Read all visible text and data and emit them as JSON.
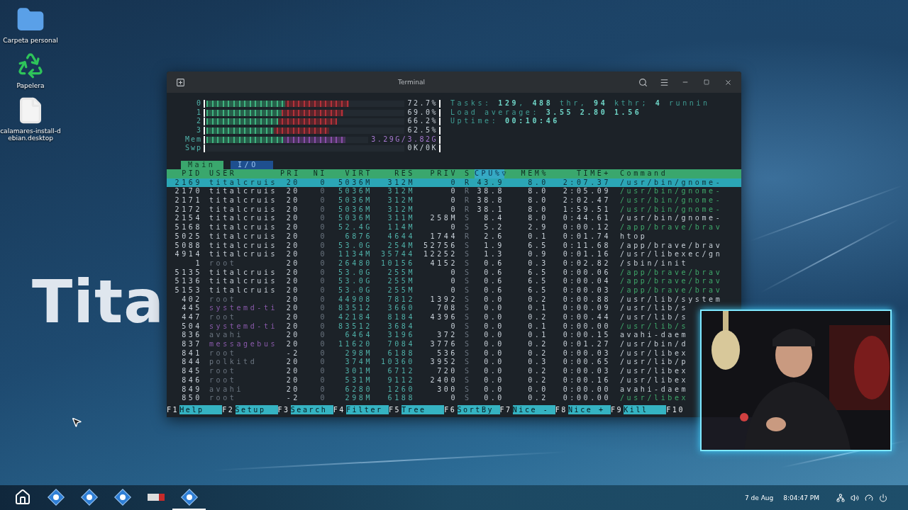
{
  "desktop": {
    "wallpaper_text": "Tita",
    "icons": [
      {
        "kind": "folder",
        "label": "Carpeta personal"
      },
      {
        "kind": "trash",
        "label": "Papelera"
      },
      {
        "kind": "file",
        "label": "calamares-install-debian.desktop"
      }
    ]
  },
  "terminal": {
    "title": "Terminal",
    "meters": [
      {
        "kind": "cpu",
        "label": "0",
        "level": 0.72,
        "reading": "72.7%"
      },
      {
        "kind": "cpu",
        "label": "1",
        "level": 0.69,
        "reading": "69.0%"
      },
      {
        "kind": "cpu",
        "label": "2",
        "level": 0.66,
        "reading": "66.2%"
      },
      {
        "kind": "cpu",
        "label": "3",
        "level": 0.62,
        "reading": "62.5%"
      },
      {
        "kind": "mem",
        "label": "Mem",
        "level": 0.86,
        "reading": "3.29G/3.82G"
      },
      {
        "kind": "swap",
        "label": "Swp",
        "level": 0,
        "reading": "0K/0K"
      }
    ],
    "summary": [
      "Tasks: **129**, **488** thr, **94** kthr; **4** runnin",
      "Load average: **3.55** **2.80** **1.56**",
      "Uptime: **00:10:46**"
    ],
    "tabs": [
      {
        "label": "Main",
        "selected": true
      },
      {
        "label": "I/O",
        "selected": false
      }
    ],
    "columns": [
      {
        "label": "PID",
        "sorted": false
      },
      {
        "label": "USER",
        "sorted": false
      },
      {
        "label": "PRI",
        "sorted": false
      },
      {
        "label": "NI",
        "sorted": false
      },
      {
        "label": "VIRT",
        "sorted": false
      },
      {
        "label": "RES",
        "sorted": false
      },
      {
        "label": "PRIV",
        "sorted": false
      },
      {
        "label": "S",
        "sorted": false
      },
      {
        "label": "CPU%▽",
        "sorted": true
      },
      {
        "label": "MEM%",
        "sorted": false
      },
      {
        "label": "TIME+",
        "sorted": false
      },
      {
        "label": "Command",
        "sorted": false
      }
    ],
    "rows": [
      {
        "cells": [
          "2169",
          "titalcruis",
          "20",
          "0",
          "5036M",
          "312M",
          "0",
          "R",
          "43.9",
          "8.0",
          "2:07.37",
          "/usr/bin/gnome-"
        ],
        "selected": true,
        "thread": false,
        "kind": "owner"
      },
      {
        "cells": [
          "2170",
          "titalcruis",
          "20",
          "0",
          "5036M",
          "312M",
          "0",
          "R",
          "38.8",
          "8.0",
          "2:05.09",
          "/usr/bin/gnome-"
        ],
        "selected": false,
        "thread": true,
        "kind": "owner"
      },
      {
        "cells": [
          "2171",
          "titalcruis",
          "20",
          "0",
          "5036M",
          "312M",
          "0",
          "R",
          "38.8",
          "8.0",
          "2:02.47",
          "/usr/bin/gnome-"
        ],
        "selected": false,
        "thread": true,
        "kind": "owner"
      },
      {
        "cells": [
          "2172",
          "titalcruis",
          "20",
          "0",
          "5036M",
          "312M",
          "0",
          "R",
          "38.1",
          "8.0",
          "1:59.51",
          "/usr/bin/gnome-"
        ],
        "selected": false,
        "thread": true,
        "kind": "owner"
      },
      {
        "cells": [
          "2154",
          "titalcruis",
          "20",
          "0",
          "5036M",
          "311M",
          "258M",
          "S",
          "8.4",
          "8.0",
          "0:44.61",
          "/usr/bin/gnome-"
        ],
        "selected": false,
        "thread": false,
        "kind": "owner"
      },
      {
        "cells": [
          "5168",
          "titalcruis",
          "20",
          "0",
          "52.4G",
          "114M",
          "0",
          "S",
          "5.2",
          "2.9",
          "0:00.12",
          "/app/brave/brav"
        ],
        "selected": false,
        "thread": true,
        "kind": "owner"
      },
      {
        "cells": [
          "5025",
          "titalcruis",
          "20",
          "0",
          "6876",
          "4644",
          "1744",
          "R",
          "2.6",
          "0.1",
          "0:01.74",
          "htop"
        ],
        "selected": false,
        "thread": false,
        "kind": "owner"
      },
      {
        "cells": [
          "5088",
          "titalcruis",
          "20",
          "0",
          "53.0G",
          "254M",
          "52756",
          "S",
          "1.9",
          "6.5",
          "0:11.68",
          "/app/brave/brav"
        ],
        "selected": false,
        "thread": false,
        "kind": "owner"
      },
      {
        "cells": [
          "4914",
          "titalcruis",
          "20",
          "0",
          "1134M",
          "35744",
          "12252",
          "S",
          "1.3",
          "0.9",
          "0:01.16",
          "/usr/libexec/gn"
        ],
        "selected": false,
        "thread": false,
        "kind": "owner"
      },
      {
        "cells": [
          "1",
          "root",
          "20",
          "0",
          "26480",
          "10156",
          "4152",
          "S",
          "0.6",
          "0.3",
          "0:02.82",
          "/sbin/init"
        ],
        "selected": false,
        "thread": false,
        "kind": "system"
      },
      {
        "cells": [
          "5135",
          "titalcruis",
          "20",
          "0",
          "53.0G",
          "255M",
          "0",
          "S",
          "0.6",
          "6.5",
          "0:00.06",
          "/app/brave/brav"
        ],
        "selected": false,
        "thread": true,
        "kind": "owner"
      },
      {
        "cells": [
          "5136",
          "titalcruis",
          "20",
          "0",
          "53.0G",
          "255M",
          "0",
          "S",
          "0.6",
          "6.5",
          "0:00.04",
          "/app/brave/brav"
        ],
        "selected": false,
        "thread": true,
        "kind": "owner"
      },
      {
        "cells": [
          "5153",
          "titalcruis",
          "20",
          "0",
          "53.0G",
          "255M",
          "0",
          "S",
          "0.6",
          "6.5",
          "0:00.03",
          "/app/brave/brav"
        ],
        "selected": false,
        "thread": true,
        "kind": "owner"
      },
      {
        "cells": [
          "402",
          "root",
          "20",
          "0",
          "44908",
          "7812",
          "1392",
          "S",
          "0.0",
          "0.2",
          "0:00.88",
          "/usr/lib/system"
        ],
        "selected": false,
        "thread": false,
        "kind": "system"
      },
      {
        "cells": [
          "445",
          "systemd-ti",
          "20",
          "0",
          "83512",
          "3660",
          "708",
          "S",
          "0.0",
          "0.1",
          "0:00.09",
          "/usr/lib/s"
        ],
        "selected": false,
        "thread": false,
        "kind": "service"
      },
      {
        "cells": [
          "447",
          "root",
          "20",
          "0",
          "42184",
          "8184",
          "4396",
          "S",
          "0.0",
          "0.2",
          "0:00.44",
          "/usr/lib/s"
        ],
        "selected": false,
        "thread": false,
        "kind": "system"
      },
      {
        "cells": [
          "504",
          "systemd-ti",
          "20",
          "0",
          "83512",
          "3684",
          "0",
          "S",
          "0.0",
          "0.1",
          "0:00.00",
          "/usr/lib/s"
        ],
        "selected": false,
        "thread": true,
        "kind": "service"
      },
      {
        "cells": [
          "836",
          "avahi",
          "20",
          "0",
          "6464",
          "3196",
          "372",
          "S",
          "0.0",
          "0.1",
          "0:00.15",
          "avahi-daem"
        ],
        "selected": false,
        "thread": false,
        "kind": "system"
      },
      {
        "cells": [
          "837",
          "messagebus",
          "20",
          "0",
          "11620",
          "7084",
          "3776",
          "S",
          "0.0",
          "0.2",
          "0:01.27",
          "/usr/bin/d"
        ],
        "selected": false,
        "thread": false,
        "kind": "service"
      },
      {
        "cells": [
          "841",
          "root",
          "-2",
          "0",
          "298M",
          "6188",
          "536",
          "S",
          "0.0",
          "0.2",
          "0:00.03",
          "/usr/libex"
        ],
        "selected": false,
        "thread": false,
        "kind": "system"
      },
      {
        "cells": [
          "844",
          "polkitd",
          "20",
          "0",
          "374M",
          "10360",
          "3952",
          "S",
          "0.0",
          "0.3",
          "0:00.65",
          "/usr/lib/p"
        ],
        "selected": false,
        "thread": false,
        "kind": "system"
      },
      {
        "cells": [
          "845",
          "root",
          "20",
          "0",
          "301M",
          "6712",
          "720",
          "S",
          "0.0",
          "0.2",
          "0:00.03",
          "/usr/libex"
        ],
        "selected": false,
        "thread": false,
        "kind": "system"
      },
      {
        "cells": [
          "846",
          "root",
          "20",
          "0",
          "531M",
          "9112",
          "2400",
          "S",
          "0.0",
          "0.2",
          "0:00.16",
          "/usr/libex"
        ],
        "selected": false,
        "thread": false,
        "kind": "system"
      },
      {
        "cells": [
          "849",
          "avahi",
          "20",
          "0",
          "6280",
          "1260",
          "300",
          "S",
          "0.0",
          "0.0",
          "0:00.00",
          "avahi-daem"
        ],
        "selected": false,
        "thread": false,
        "kind": "system"
      },
      {
        "cells": [
          "850",
          "root",
          "-2",
          "0",
          "298M",
          "6188",
          "0",
          "S",
          "0.0",
          "0.2",
          "0:00.00",
          "/usr/libex"
        ],
        "selected": false,
        "thread": true,
        "kind": "system"
      }
    ],
    "function_keys": [
      {
        "key": "F1",
        "label": "Help"
      },
      {
        "key": "F2",
        "label": "Setup"
      },
      {
        "key": "F3",
        "label": "Search"
      },
      {
        "key": "F4",
        "label": "Filter"
      },
      {
        "key": "F5",
        "label": "Tree"
      },
      {
        "key": "F6",
        "label": "SortBy"
      },
      {
        "key": "F7",
        "label": "Nice -"
      },
      {
        "key": "F8",
        "label": "Nice +"
      },
      {
        "key": "F9",
        "label": "Kill"
      },
      {
        "key": "F10"
      }
    ]
  },
  "taskbar": {
    "apps": [
      {
        "kind": "home",
        "active": false
      },
      {
        "kind": "app",
        "active": false
      },
      {
        "kind": "app",
        "active": false
      },
      {
        "kind": "app",
        "active": false
      },
      {
        "kind": "logo",
        "active": false
      },
      {
        "kind": "app",
        "active": true
      }
    ],
    "date": "7 de Aug",
    "time": "8:04:47 PM"
  }
}
